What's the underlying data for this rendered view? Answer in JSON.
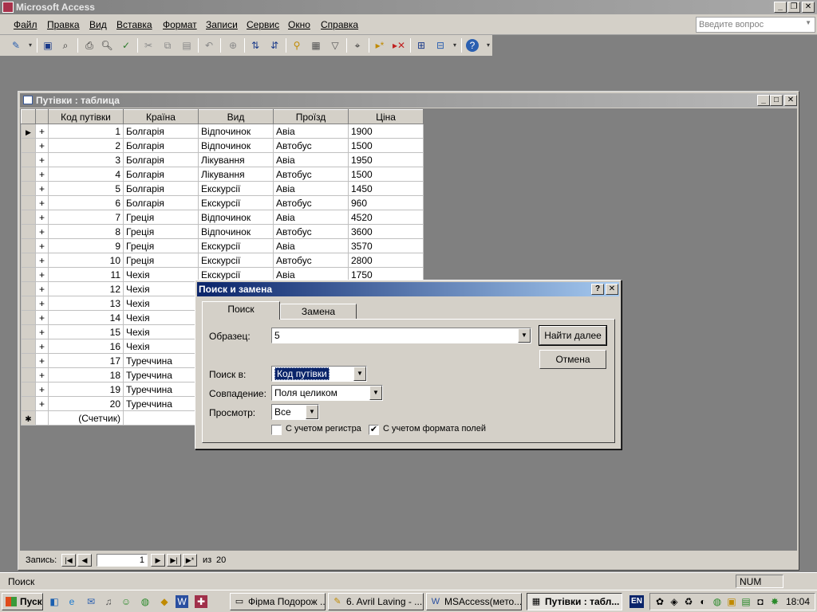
{
  "app": {
    "title": "Microsoft Access"
  },
  "menu": {
    "items": [
      "Файл",
      "Правка",
      "Вид",
      "Вставка",
      "Формат",
      "Записи",
      "Сервис",
      "Окно",
      "Справка"
    ],
    "question_placeholder": "Введите вопрос"
  },
  "toolbar": {
    "icons": [
      "design-view-icon",
      "save-icon",
      "file-search-icon",
      "print-icon",
      "print-preview-icon",
      "spelling-icon",
      "cut-icon",
      "copy-icon",
      "paste-icon",
      "undo-icon",
      "hyperlink-icon",
      "sort-ascending-icon",
      "sort-descending-icon",
      "filter-by-selection-icon",
      "filter-by-form-icon",
      "apply-filter-icon",
      "find-icon",
      "new-record-icon",
      "delete-record-icon",
      "database-window-icon",
      "new-object-icon",
      "help-icon"
    ]
  },
  "table_window": {
    "title": "Путівки : таблица",
    "columns": [
      "Код путівки",
      "Країна",
      "Вид",
      "Проїзд",
      "Ціна"
    ],
    "rows": [
      [
        "1",
        "Болгарія",
        "Відпочинок",
        "Авіа",
        "1900"
      ],
      [
        "2",
        "Болгарія",
        "Відпочинок",
        "Автобус",
        "1500"
      ],
      [
        "3",
        "Болгарія",
        "Лікування",
        "Авіа",
        "1950"
      ],
      [
        "4",
        "Болгарія",
        "Лікування",
        "Автобус",
        "1500"
      ],
      [
        "5",
        "Болгарія",
        "Екскурсії",
        "Авіа",
        "1450"
      ],
      [
        "6",
        "Болгарія",
        "Екскурсії",
        "Автобус",
        "960"
      ],
      [
        "7",
        "Греція",
        "Відпочинок",
        "Авіа",
        "4520"
      ],
      [
        "8",
        "Греція",
        "Відпочинок",
        "Автобус",
        "3600"
      ],
      [
        "9",
        "Греція",
        "Екскурсії",
        "Авіа",
        "3570"
      ],
      [
        "10",
        "Греція",
        "Екскурсії",
        "Автобус",
        "2800"
      ],
      [
        "11",
        "Чехія",
        "Екскурсії",
        "Авіа",
        "1750"
      ],
      [
        "12",
        "Чехія",
        "",
        "",
        ""
      ],
      [
        "13",
        "Чехія",
        "",
        "",
        ""
      ],
      [
        "14",
        "Чехія",
        "",
        "",
        ""
      ],
      [
        "15",
        "Чехія",
        "",
        "",
        ""
      ],
      [
        "16",
        "Чехія",
        "",
        "",
        ""
      ],
      [
        "17",
        "Туреччина",
        "",
        "",
        ""
      ],
      [
        "18",
        "Туреччина",
        "",
        "",
        ""
      ],
      [
        "19",
        "Туреччина",
        "",
        "",
        ""
      ],
      [
        "20",
        "Туреччина",
        "",
        "",
        ""
      ]
    ],
    "new_row_label": "(Счетчик)",
    "expand_symbol": "+",
    "nav": {
      "label": "Запись:",
      "current": "1",
      "of_label": "из",
      "total": "20"
    }
  },
  "dialog": {
    "title": "Поиск и замена",
    "tabs": [
      "Поиск",
      "Замена"
    ],
    "find_label": "Образец:",
    "find_value": "5",
    "find_next_label": "Найти далее",
    "cancel_label": "Отмена",
    "look_in_label": "Поиск в:",
    "look_in_value": "Код путівки",
    "match_label": "Совпадение:",
    "match_value": "Поля целиком",
    "search_label": "Просмотр:",
    "search_value": "Все",
    "match_case_label": "С учетом регистра",
    "match_case_checked": false,
    "format_label": "С учетом формата полей",
    "format_checked": true
  },
  "statusbar": {
    "mode": "Поиск",
    "num": "NUM"
  },
  "taskbar": {
    "start_label": "Пуск",
    "buttons": [
      "Фірма Подорож ...",
      "6. Avril Laving - ...",
      "MSAccess(мето...",
      "Путівки : табл..."
    ],
    "lang": "EN",
    "clock": "18:04"
  }
}
